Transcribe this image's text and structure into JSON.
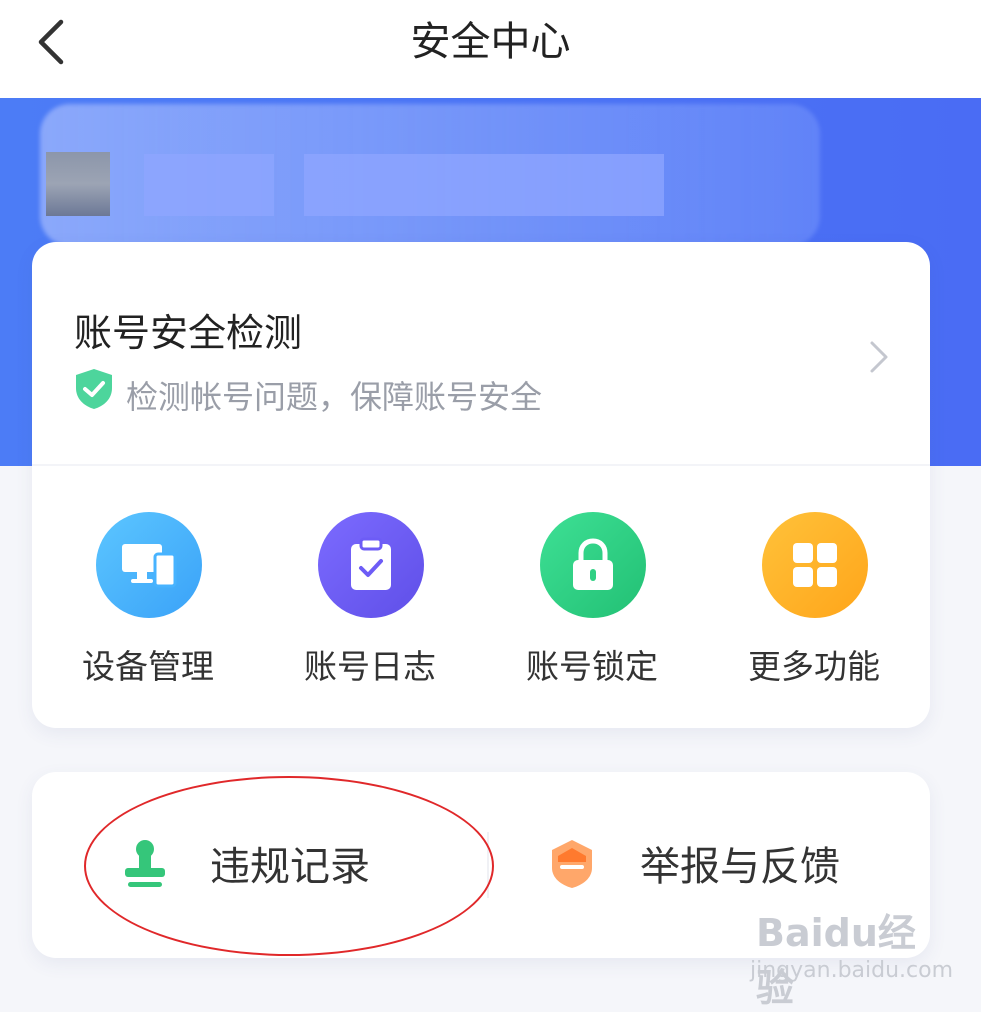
{
  "header": {
    "title": "安全中心",
    "back_icon": "chevron-left-icon"
  },
  "colors": {
    "hero": "#4c7cf6",
    "shield": "#4dd59c",
    "device": "#4ab3ff",
    "log": "#6d5cf6",
    "lock": "#2fd083",
    "more": "#ffb524",
    "stamp": "#35c67a",
    "report": "#ff8a3d",
    "highlight": "#e0282a"
  },
  "security_check": {
    "title": "账号安全检测",
    "subtitle": "检测帐号问题，保障账号安全"
  },
  "features": [
    {
      "label": "设备管理",
      "icon": "devices-icon"
    },
    {
      "label": "账号日志",
      "icon": "clipboard-check-icon"
    },
    {
      "label": "账号锁定",
      "icon": "lock-icon"
    },
    {
      "label": "更多功能",
      "icon": "grid-icon"
    }
  ],
  "bottom": {
    "violation_label": "违规记录",
    "violation_icon": "stamp-icon",
    "report_label": "举报与反馈",
    "report_icon": "report-badge-icon"
  },
  "watermark": {
    "logo": "Baidu经验",
    "url": "jingyan.baidu.com"
  }
}
